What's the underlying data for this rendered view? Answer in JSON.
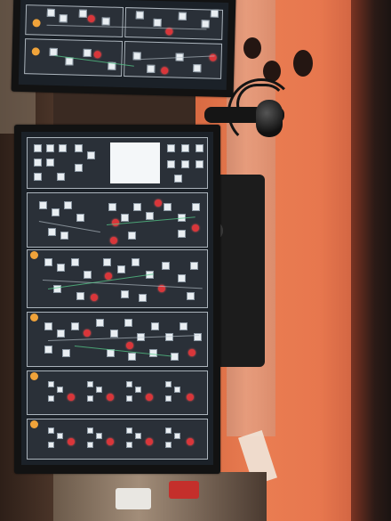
{
  "photo": {
    "subject": "two monitors",
    "colors": {
      "wall": "#e4774c",
      "wall_shadow": "#c8573a",
      "left_bg": "#3b2a20",
      "screen_bg": "#1b2128",
      "tile": "#e9eef2",
      "alarm_red": "#d9363a",
      "orange_marker": "#f0a33a"
    }
  }
}
